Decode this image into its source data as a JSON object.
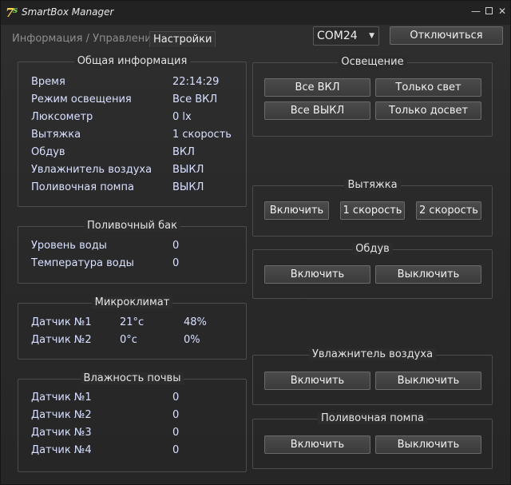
{
  "window": {
    "title": "SmartBox Manager",
    "logo_main": "7",
    "logo_small": "s",
    "min_glyph": "—",
    "close_glyph": "✕"
  },
  "tabs": [
    {
      "label": "Информация / Управление",
      "active": false
    },
    {
      "label": "Настройки",
      "active": true
    }
  ],
  "port": {
    "selected": "COM24",
    "arrow": "▼"
  },
  "disconnect_label": "Отключиться",
  "general": {
    "title": "Общая информация",
    "rows": [
      {
        "label": "Время",
        "value": "22:14:29"
      },
      {
        "label": "Режим освещения",
        "value": "Все ВКЛ"
      },
      {
        "label": "Люксометр",
        "value": "0 lx"
      },
      {
        "label": "Вытяжка",
        "value": "1 скорость"
      },
      {
        "label": "Обдув",
        "value": "ВКЛ"
      },
      {
        "label": "Увлажнитель воздуха",
        "value": "ВЫКЛ"
      },
      {
        "label": "Поливочная помпа",
        "value": "ВЫКЛ"
      }
    ]
  },
  "tank": {
    "title": "Поливочный бак",
    "rows": [
      {
        "label": "Уровень воды",
        "value": "0"
      },
      {
        "label": "Температура воды",
        "value": "0"
      }
    ]
  },
  "climate": {
    "title": "Микроклимат",
    "rows": [
      {
        "label": "Датчик №1",
        "temp": "21°c",
        "hum": "48%"
      },
      {
        "label": "Датчик №2",
        "temp": "0°c",
        "hum": "0%"
      }
    ]
  },
  "soil": {
    "title": "Влажность почвы",
    "rows": [
      {
        "label": "Датчик №1",
        "value": "0"
      },
      {
        "label": "Датчик №2",
        "value": "0"
      },
      {
        "label": "Датчик №3",
        "value": "0"
      },
      {
        "label": "Датчик №4",
        "value": "0"
      }
    ]
  },
  "lighting": {
    "title": "Освещение",
    "all_on": "Все ВКЛ",
    "light_only": "Только свет",
    "all_off": "Все ВЫКЛ",
    "supplement_only": "Только досвет"
  },
  "exhaust": {
    "title": "Вытяжка",
    "on": "Включить",
    "speed1": "1 скорость",
    "speed2": "2 скорость"
  },
  "fan": {
    "title": "Обдув",
    "on": "Включить",
    "off": "Выключить"
  },
  "humidifier": {
    "title": "Увлажнитель воздуха",
    "on": "Включить",
    "off": "Выключить"
  },
  "pump": {
    "title": "Поливочная помпа",
    "on": "Включить",
    "off": "Выключить"
  }
}
